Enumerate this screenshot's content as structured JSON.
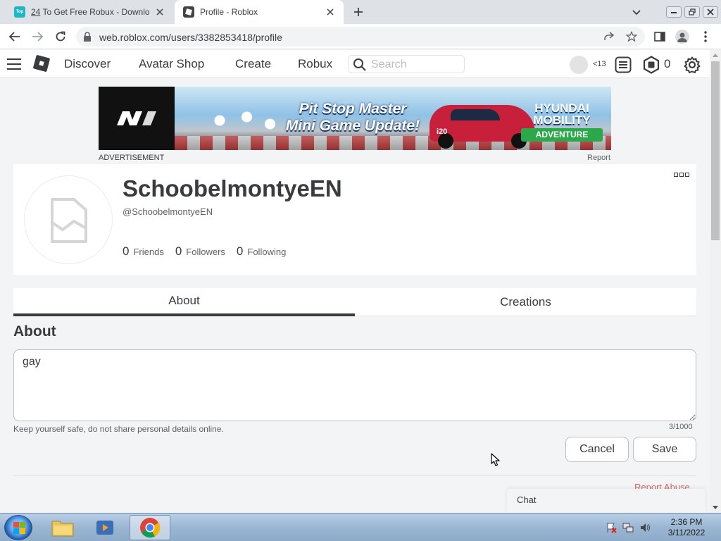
{
  "browser": {
    "tabs": [
      {
        "favicon_text": "Top",
        "number": "24",
        "title": " To Get Free Robux - Download"
      },
      {
        "title": "Profile - Roblox"
      }
    ],
    "url": "web.roblox.com/users/3382853418/profile"
  },
  "nav": {
    "links": [
      "Discover",
      "Avatar Shop",
      "Create",
      "Robux"
    ],
    "search_placeholder": "Search",
    "age_label": "<13",
    "robux_count": "0"
  },
  "ad": {
    "headline_1": "Pit Stop Master",
    "headline_2": "Mini Game Update!",
    "sponsor_1": "HYUNDAI",
    "sponsor_2": "MOBILITY",
    "sponsor_3": "ADVENTURE",
    "car_number": "i20",
    "label": "ADVERTISEMENT",
    "report": "Report"
  },
  "profile": {
    "display_name": "SchoobelmontyeEN",
    "username": "@SchoobelmontyeEN",
    "stats": [
      {
        "value": "0",
        "label": "Friends"
      },
      {
        "value": "0",
        "label": "Followers"
      },
      {
        "value": "0",
        "label": "Following"
      }
    ]
  },
  "tabs": {
    "about": "About",
    "creations": "Creations"
  },
  "about": {
    "heading": "About",
    "text": "gay",
    "hint": "Keep yourself safe, do not share personal details online.",
    "counter": "3/1000",
    "cancel": "Cancel",
    "save": "Save"
  },
  "footer": {
    "report_abuse": "Report Abuse",
    "chat": "Chat"
  },
  "taskbar": {
    "time": "2:36 PM",
    "date": "3/11/2022"
  },
  "colors": {
    "roblox_text": "#393b3d",
    "report_red": "#d86868",
    "chrome_tab_bg": "#dee1e6"
  }
}
